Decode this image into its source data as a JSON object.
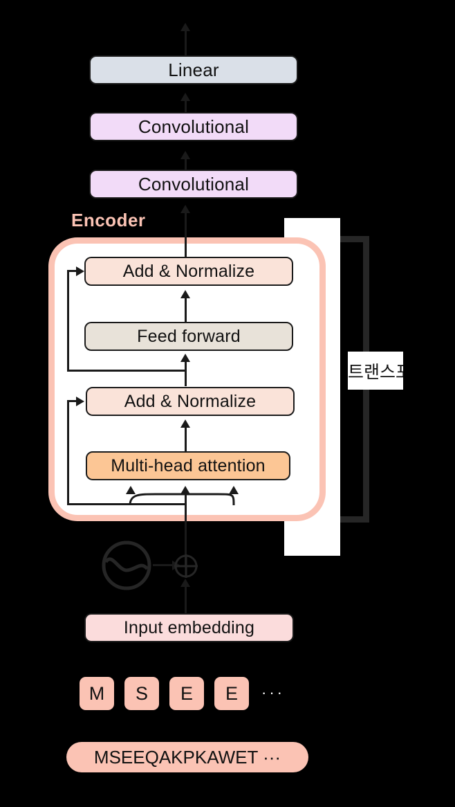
{
  "diagram": {
    "title": "Protein sequence transformer encoder architecture",
    "colors": {
      "background": "#000000",
      "linear": "#dae0e8",
      "convolutional": "#f2dbf8",
      "add_normalize": "#fae3d9",
      "feed_forward": "#e8e2d9",
      "multi_head_attention": "#fcc695",
      "input_embedding": "#fbdcdc",
      "token_chip": "#fbc3b4",
      "encoder_border": "#fbc3b4",
      "encoder_label": "#fbc3b4",
      "stroke": "#1a1a1a",
      "panel": "#ffffff"
    }
  },
  "stack": {
    "linear": "Linear",
    "conv_top": "Convolutional",
    "conv_bottom": "Convolutional",
    "input_embedding": "Input embedding"
  },
  "encoder": {
    "label": "Encoder",
    "add_normalize_top": "Add & Normalize",
    "feed_forward": "Feed forward",
    "add_normalize_bottom": "Add & Normalize",
    "multi_head_attention": "Multi-head attention"
  },
  "bracket": {
    "label": "트랜스포"
  },
  "tokens": {
    "items": [
      "M",
      "S",
      "E",
      "E"
    ],
    "ellipsis": "···"
  },
  "sequence": {
    "text": "MSEEQAKPKAWET  ···"
  },
  "icons": {
    "positional_encoding": "sine-wave-circle-icon",
    "residual_add": "circled-plus-icon",
    "flow_arrow": "arrow-up-icon"
  }
}
